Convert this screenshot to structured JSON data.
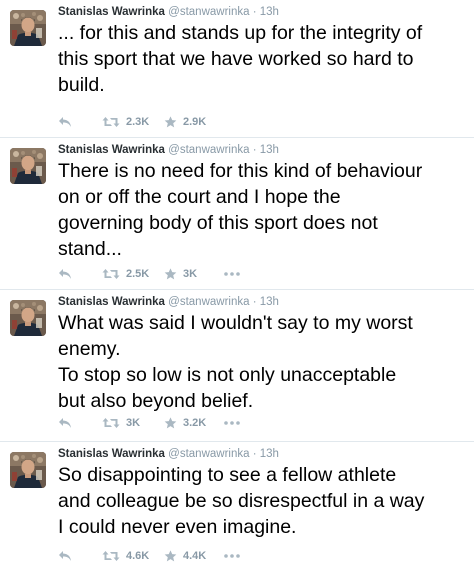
{
  "tweets": [
    {
      "name": "Stanislas Wawrinka",
      "handle": "@stanwawrinka",
      "separator": "·",
      "time": "13h",
      "text": "... for this and stands up for the integrity of\nthis sport that we have worked so hard to\nbuild.",
      "retweets": "2.3K",
      "favorites": "2.9K",
      "has_more": false
    },
    {
      "name": "Stanislas Wawrinka",
      "handle": "@stanwawrinka",
      "separator": "·",
      "time": "13h",
      "text": "There is no need for this kind of behaviour\non or off the court and I hope the\ngoverning body of this sport does not\nstand...",
      "retweets": "2.5K",
      "favorites": "3K",
      "has_more": true
    },
    {
      "name": "Stanislas Wawrinka",
      "handle": "@stanwawrinka",
      "separator": "·",
      "time": "13h",
      "text": "What was said I wouldn't say to my worst\nenemy.\nTo stop so low is not only unacceptable\nbut also beyond belief.",
      "retweets": "3K",
      "favorites": "3.2K",
      "has_more": true
    },
    {
      "name": "Stanislas Wawrinka",
      "handle": "@stanwawrinka",
      "separator": "·",
      "time": "13h",
      "text": "So disappointing to see a fellow athlete\nand colleague be so disrespectful in a way\nI could never even imagine.",
      "retweets": "4.6K",
      "favorites": "4.4K",
      "has_more": true
    }
  ],
  "icons": {
    "reply": "reply-icon",
    "retweet": "retweet-icon",
    "favorite": "star-icon",
    "more": "more-dots-icon"
  },
  "colors": {
    "name": "#292f33",
    "meta": "#8899a6",
    "text": "#000000",
    "icon": "#aab8c2",
    "divider": "#e1e8ed"
  }
}
